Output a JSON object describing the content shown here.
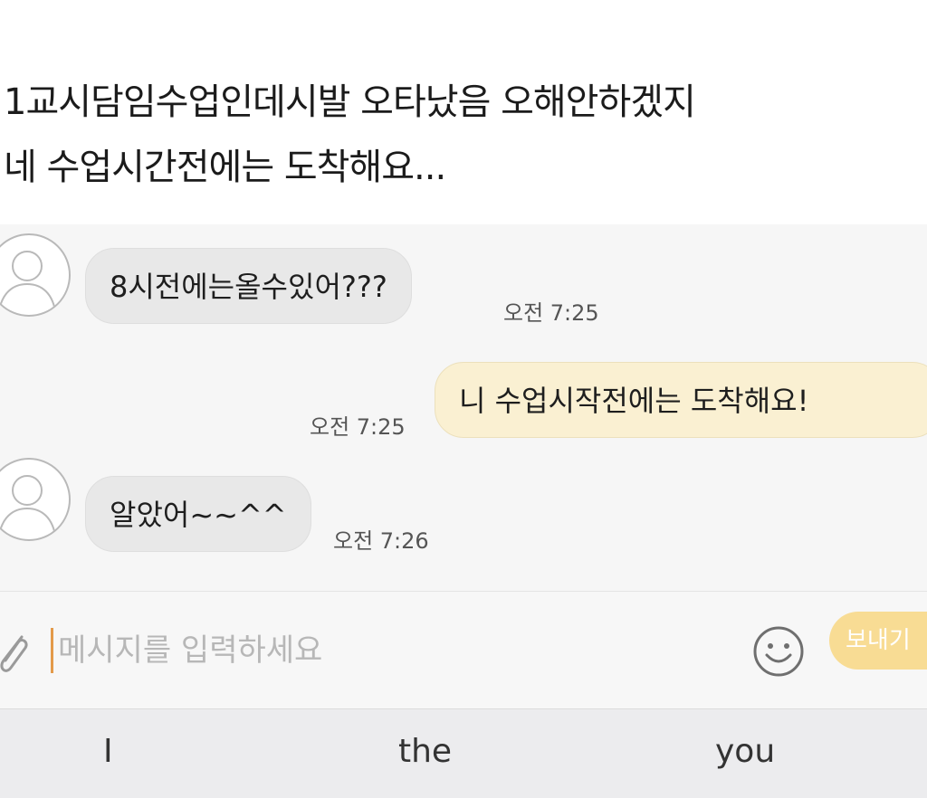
{
  "caption": {
    "line1": "1교시담임수업인데시발 오타났음 오해안하겠지",
    "line2": "네 수업시간전에는 도착해요..."
  },
  "messages": [
    {
      "direction": "incoming",
      "text": "8시전에는올수있어???",
      "time": "오전 7:25"
    },
    {
      "direction": "outgoing",
      "text": "니 수업시작전에는 도착해요!",
      "time": "오전 7:25"
    },
    {
      "direction": "incoming",
      "text": "알았어~~^^",
      "time": "오전 7:26"
    }
  ],
  "input": {
    "placeholder": "메시지를 입력하세요",
    "send_label": "보내기"
  },
  "keyboard": {
    "suggestions": [
      "I",
      "the",
      "you"
    ]
  },
  "colors": {
    "incoming_bubble": "#e8e8e8",
    "outgoing_bubble": "#faf0d2",
    "send_button": "#f8dc94",
    "chat_background": "#f6f6f6"
  },
  "icons": [
    "avatar-icon",
    "paperclip-icon",
    "emoji-icon"
  ]
}
